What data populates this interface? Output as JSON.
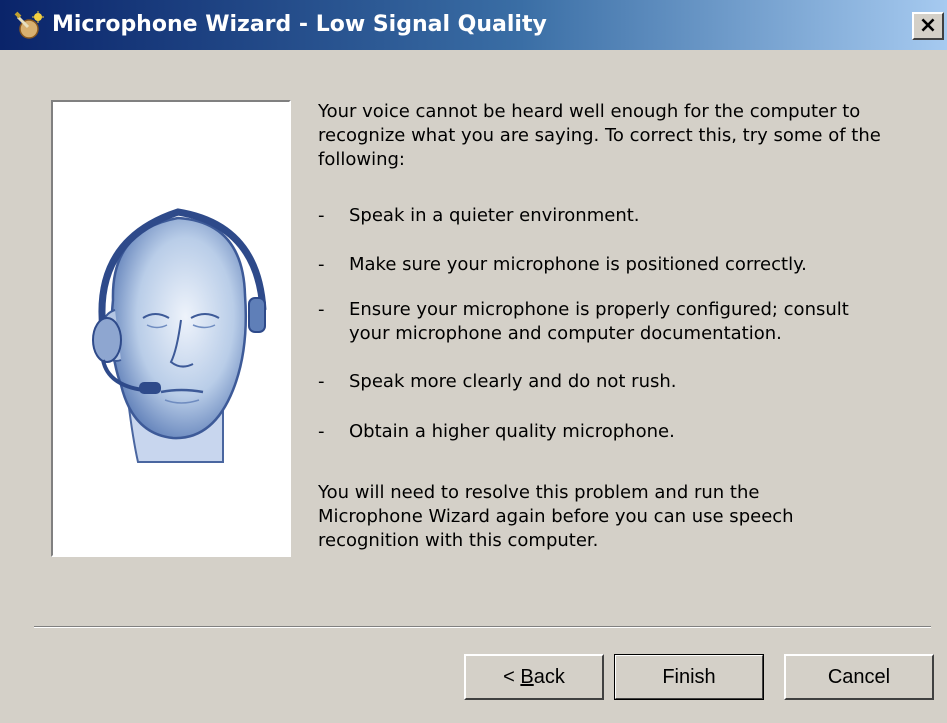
{
  "window": {
    "title": "Microphone Wizard - Low Signal Quality",
    "close_glyph": "×"
  },
  "content": {
    "intro": "Your voice cannot be heard well enough for the computer to recognize what you are saying. To correct this, try some of the following:",
    "bullet_marker": "-",
    "bullets": [
      "Speak in a quieter environment.",
      "Make sure your microphone is positioned correctly.",
      "Ensure your microphone is properly configured;  consult your microphone and computer documentation.",
      "Speak more clearly and do not rush.",
      "Obtain a higher quality microphone."
    ],
    "closing": "You will need to resolve this problem and run the Microphone Wizard again before you can use speech recognition with this computer."
  },
  "buttons": {
    "back_prefix": "< ",
    "back_accel": "B",
    "back_rest": "ack",
    "finish": "Finish",
    "cancel": "Cancel"
  },
  "icons": {
    "app": "microphone-wizard-icon",
    "illustration": "headset-head-illustration"
  }
}
